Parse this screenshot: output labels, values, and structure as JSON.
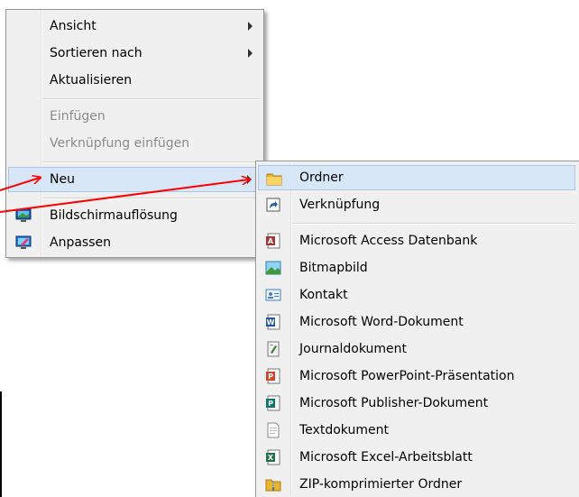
{
  "context_menu": {
    "items": [
      {
        "label": "Ansicht",
        "submenu": true
      },
      {
        "label": "Sortieren nach",
        "submenu": true
      },
      {
        "label": "Aktualisieren"
      },
      {
        "label": "Einfügen",
        "disabled": true
      },
      {
        "label": "Verknüpfung einfügen",
        "disabled": true
      },
      {
        "label": "Neu",
        "submenu": true,
        "highlighted": true
      },
      {
        "label": "Bildschirmauflösung",
        "icon": "display-icon"
      },
      {
        "label": "Anpassen",
        "icon": "personalize-icon"
      }
    ]
  },
  "new_submenu": {
    "items": [
      {
        "label": "Ordner",
        "icon": "folder-icon",
        "highlighted": true
      },
      {
        "label": "Verknüpfung",
        "icon": "shortcut-icon"
      },
      {
        "label": "Microsoft Access Datenbank",
        "icon": "access-icon"
      },
      {
        "label": "Bitmapbild",
        "icon": "bitmap-icon"
      },
      {
        "label": "Kontakt",
        "icon": "contact-icon"
      },
      {
        "label": "Microsoft Word-Dokument",
        "icon": "word-icon"
      },
      {
        "label": "Journaldokument",
        "icon": "journal-icon"
      },
      {
        "label": "Microsoft PowerPoint-Präsentation",
        "icon": "powerpoint-icon"
      },
      {
        "label": "Microsoft Publisher-Dokument",
        "icon": "publisher-icon"
      },
      {
        "label": "Textdokument",
        "icon": "text-document-icon"
      },
      {
        "label": "Microsoft Excel-Arbeitsblatt",
        "icon": "excel-icon"
      },
      {
        "label": "ZIP-komprimierter Ordner",
        "icon": "zip-folder-icon"
      }
    ]
  },
  "colors": {
    "menu_background": "#f0f0f0",
    "highlight": "#d7e7f7",
    "highlight_border": "#a8c8ea",
    "annotation_arrow": "#ff0000",
    "disabled_text": "#8b8b8b"
  }
}
